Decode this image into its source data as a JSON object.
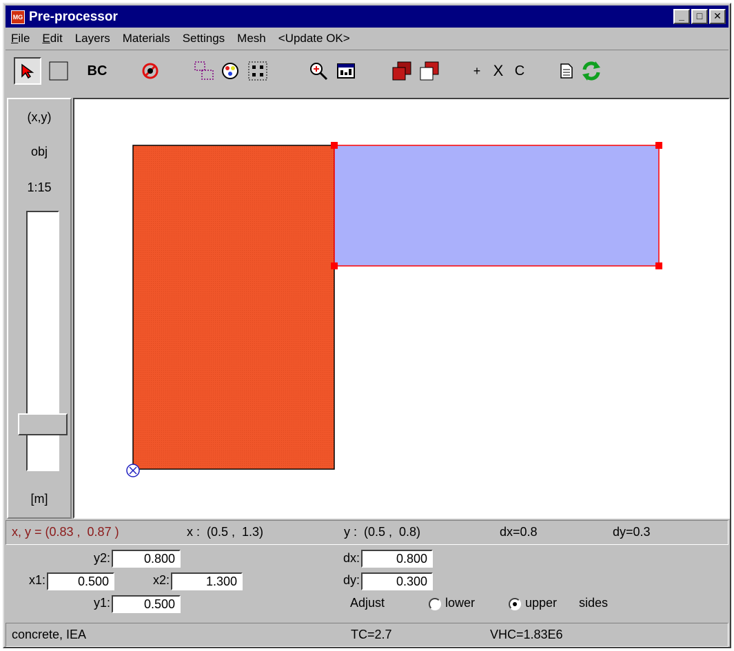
{
  "window": {
    "title": "Pre-processor",
    "icon_text": "MG"
  },
  "title_buttons": {
    "minimize": "_",
    "maximize": "□",
    "close": "✕"
  },
  "menu": [
    {
      "accel": "F",
      "rest": "ile"
    },
    {
      "accel": "E",
      "rest": "dit"
    },
    {
      "label": "Layers"
    },
    {
      "label": "Materials"
    },
    {
      "label": "Settings"
    },
    {
      "label": "Mesh"
    },
    {
      "label": "<Update OK>"
    }
  ],
  "toolbar": {
    "bc_label": "BC",
    "plus_label": "+",
    "x_label": "X",
    "c_label": "C"
  },
  "left_panel": {
    "xy": "(x,y)",
    "obj": "obj",
    "scale": "1:15",
    "unit": "[m]"
  },
  "status": {
    "cursor": "x, y = (0.83 ,  0.87 )",
    "x_range": "x :  (0.5 ,  1.3)",
    "y_range": "y :  (0.5 ,  0.8)",
    "dx": "dx=0.8",
    "dy": "dy=0.3",
    "cursor_color": "#8b1a1a"
  },
  "coords": {
    "y2_label": "y2:",
    "y2_value": "0.800",
    "x1_label": "x1:",
    "x1_value": "0.500",
    "x2_label": "x2:",
    "x2_value": "1.300",
    "y1_label": "y1:",
    "y1_value": "0.500",
    "dx_label": "dx:",
    "dx_value": "0.800",
    "dy_label": "dy:",
    "dy_value": "0.300",
    "adjust_label": "Adjust",
    "lower_label": "lower",
    "upper_label": "upper",
    "sides_label": "sides",
    "selected_side": "upper"
  },
  "footer": {
    "material": "concrete, IEA",
    "tc": "TC=2.7",
    "vhc": "VHC=1.83E6"
  },
  "colors": {
    "concrete_fill": "#f0562a",
    "selected_fill": "#aab0fb",
    "selection_handle": "#ff0000",
    "origin_marker": "#2020c0"
  },
  "slider": {
    "level": 0.85
  }
}
